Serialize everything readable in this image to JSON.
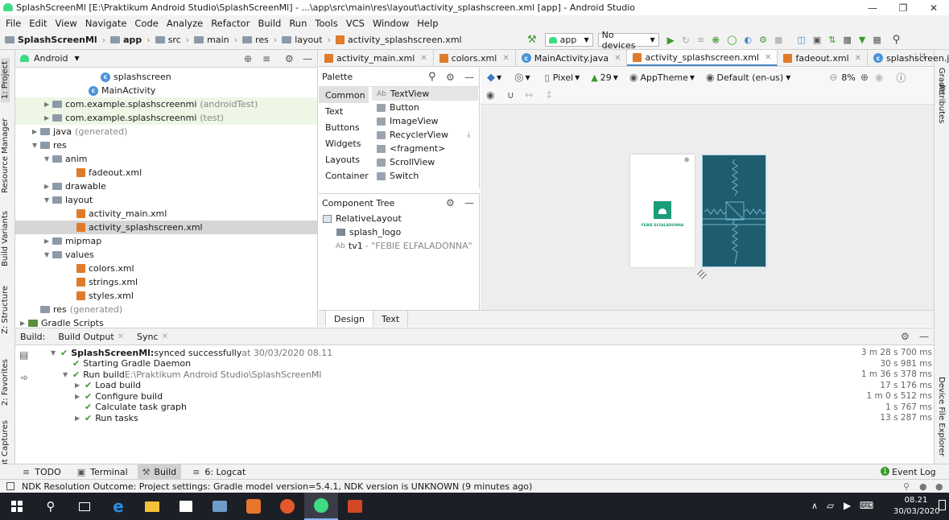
{
  "window": {
    "title": "SplashScreenMl [E:\\Praktikum Android Studio\\SplashScreenMl] - ...\\app\\src\\main\\res\\layout\\activity_splashscreen.xml [app] - Android Studio"
  },
  "menu": [
    "File",
    "Edit",
    "View",
    "Navigate",
    "Code",
    "Analyze",
    "Refactor",
    "Build",
    "Run",
    "Tools",
    "VCS",
    "Window",
    "Help"
  ],
  "breadcrumb": [
    "SplashScreenMl",
    "app",
    "src",
    "main",
    "res",
    "layout",
    "activity_splashscreen.xml"
  ],
  "toolbar": {
    "run_config": "app",
    "device": "No devices"
  },
  "project": {
    "view": "Android",
    "tree": [
      {
        "label": "splashscreen",
        "indent": 6,
        "icon": "class"
      },
      {
        "label": "MainActivity",
        "indent": 5,
        "icon": "class"
      },
      {
        "label": "com.example.splashscreenmi",
        "suffix": "(androidTest)",
        "indent": 2,
        "icon": "package",
        "arrow": "right",
        "bg": "test"
      },
      {
        "label": "com.example.splashscreenmi",
        "suffix": "(test)",
        "indent": 2,
        "icon": "package",
        "arrow": "right",
        "bg": "test"
      },
      {
        "label": "java",
        "suffix": "(generated)",
        "indent": 1,
        "icon": "folder",
        "arrow": "right"
      },
      {
        "label": "res",
        "indent": 1,
        "icon": "folder",
        "arrow": "down"
      },
      {
        "label": "anim",
        "indent": 2,
        "icon": "folder",
        "arrow": "down"
      },
      {
        "label": "fadeout.xml",
        "indent": 4,
        "icon": "xml"
      },
      {
        "label": "drawable",
        "indent": 2,
        "icon": "folder",
        "arrow": "right"
      },
      {
        "label": "layout",
        "indent": 2,
        "icon": "folder",
        "arrow": "down"
      },
      {
        "label": "activity_main.xml",
        "indent": 4,
        "icon": "xml"
      },
      {
        "label": "activity_splashscreen.xml",
        "indent": 4,
        "icon": "xml",
        "bg": "sel"
      },
      {
        "label": "mipmap",
        "indent": 2,
        "icon": "folder",
        "arrow": "right"
      },
      {
        "label": "values",
        "indent": 2,
        "icon": "folder",
        "arrow": "down"
      },
      {
        "label": "colors.xml",
        "indent": 4,
        "icon": "xml"
      },
      {
        "label": "strings.xml",
        "indent": 4,
        "icon": "xml"
      },
      {
        "label": "styles.xml",
        "indent": 4,
        "icon": "xml"
      },
      {
        "label": "res",
        "suffix": "(generated)",
        "indent": 1,
        "icon": "folder"
      },
      {
        "label": "Gradle Scripts",
        "indent": 0,
        "icon": "gradle",
        "arrow": "right"
      }
    ]
  },
  "tabs": [
    {
      "label": "activity_main.xml",
      "icon": "xml"
    },
    {
      "label": "colors.xml",
      "icon": "xml"
    },
    {
      "label": "MainActivity.java",
      "icon": "class"
    },
    {
      "label": "activity_splashscreen.xml",
      "icon": "xml",
      "active": true
    },
    {
      "label": "fadeout.xml",
      "icon": "xml"
    },
    {
      "label": "splashscreen.java",
      "icon": "class"
    }
  ],
  "tabs_overflow": "⋮¹1",
  "palette": {
    "title": "Palette",
    "categories": [
      "Common",
      "Text",
      "Buttons",
      "Widgets",
      "Layouts",
      "Container"
    ],
    "items": [
      "TextView",
      "Button",
      "ImageView",
      "RecyclerView",
      "<fragment>",
      "ScrollView",
      "Switch"
    ]
  },
  "component_tree": {
    "title": "Component Tree",
    "root": "RelativeLayout",
    "children": [
      {
        "label": "splash_logo",
        "icon": "image"
      },
      {
        "label": "tv1",
        "value": "- \"FEBIE ELFALADONNA\"",
        "icon": "text"
      }
    ]
  },
  "design_toolbar": {
    "device": "Pixel",
    "api": "29",
    "theme": "AppTheme",
    "locale": "Default (en-us)",
    "zoom": "8%"
  },
  "preview": {
    "caption": "FEBIE ELFALADONNA",
    "brand_color": "#1f5c6e",
    "logo_color": "#1b9c7a"
  },
  "design_tabs": [
    "Design",
    "Text"
  ],
  "build": {
    "tabs": [
      "Build:",
      "Build Output",
      "Sync"
    ],
    "rows": [
      {
        "bold": "SplashScreenMl:",
        "text": " synced successfully",
        "gray": " at 30/03/2020 08.11",
        "time": "3 m 28 s 700 ms",
        "indent": 0,
        "arrow": "down"
      },
      {
        "text": "Starting Gradle Daemon",
        "time": "30 s 981 ms",
        "indent": 1
      },
      {
        "text": "Run build",
        "gray": " E:\\Praktikum Android Studio\\SplashScreenMl",
        "time": "1 m 36 s 378 ms",
        "indent": 1,
        "arrow": "down"
      },
      {
        "text": "Load build",
        "time": "17 s 176 ms",
        "indent": 2,
        "arrow": "right"
      },
      {
        "text": "Configure build",
        "time": "1 m 0 s 512 ms",
        "indent": 2,
        "arrow": "right"
      },
      {
        "text": "Calculate task graph",
        "time": "1 s 767 ms",
        "indent": 2
      },
      {
        "text": "Run tasks",
        "time": "13 s 287 ms",
        "indent": 2,
        "arrow": "right"
      }
    ]
  },
  "left_tools": [
    "1: Project",
    "Resource Manager",
    "Build Variants",
    "Z: Structure",
    "2: Favorites",
    "out Captures"
  ],
  "right_tools": [
    "Gradle",
    "Attributes",
    "Device File Explorer"
  ],
  "bottom_tools": [
    "TODO",
    "Terminal",
    "Build",
    "6: Logcat"
  ],
  "event_log": "Event Log",
  "status": "NDK Resolution Outcome: Project settings: Gradle model version=5.4.1, NDK version is UNKNOWN (9 minutes ago)",
  "clock": {
    "time": "08.21",
    "date": "30/03/2020"
  }
}
